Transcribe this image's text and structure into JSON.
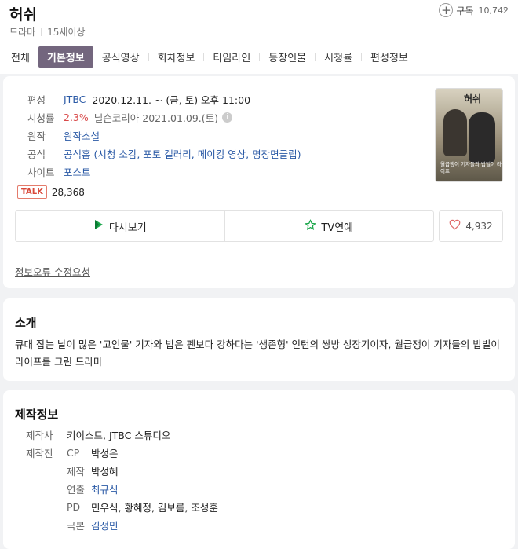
{
  "title": "허쉬",
  "genre": "드라마",
  "rating": "15세이상",
  "subscribe": {
    "label": "구독",
    "count": "10,742"
  },
  "tabs": [
    "전체",
    "기본정보",
    "공식영상",
    "회차정보",
    "타임라인",
    "등장인물",
    "시청률",
    "편성정보"
  ],
  "active_tab": "기본정보",
  "info": {
    "broadcast_label": "편성",
    "channel": "JTBC",
    "schedule": "2020.12.11. ~  (금, 토) 오후 11:00",
    "ratings_label": "시청률",
    "ratings_value": "2.3%",
    "ratings_source": "닐슨코리아 2021.01.09.(토)",
    "original_label": "원작",
    "original_value": "원작소설",
    "official_label": "공식",
    "official_value": "공식홈 (시청 소감, 포토 갤러리, 메이킹 영상, 명장면클립)",
    "site_label": "사이트",
    "site_value": "포스트"
  },
  "poster": {
    "title": "허쉬",
    "caption": "월급쟁이 기자들의 밥벌이 라이프"
  },
  "talk": {
    "badge": "TALK",
    "count": "28,368"
  },
  "actions": {
    "rewatch": "다시보기",
    "tv": "TV연예",
    "likes": "4,932"
  },
  "error_link": "정보오류 수정요청",
  "intro": {
    "heading": "소개",
    "text": "큐대 잡는 날이 많은 '고인물' 기자와 밥은 펜보다 강하다는 '생존형' 인턴의 쌍방 성장기이자, 월급쟁이 기자들의 밥벌이 라이프를 그린 드라마"
  },
  "production": {
    "heading": "제작정보",
    "company_label": "제작사",
    "company_value": "키이스트, JTBC 스튜디오",
    "staff_label": "제작진",
    "staff": [
      {
        "role": "CP",
        "names": "박성은",
        "link": false
      },
      {
        "role": "제작",
        "names": "박성혜",
        "link": false
      },
      {
        "role": "연출",
        "names": "최규식",
        "link": true
      },
      {
        "role": "PD",
        "names": "민우식, 황혜정, 김보름, 조성훈",
        "link": false
      },
      {
        "role": "극본",
        "names": "김정민",
        "link": true
      }
    ]
  },
  "colors": {
    "active_tab": "#73667e",
    "link": "#2b5aa6",
    "rating": "#d94a4a"
  }
}
